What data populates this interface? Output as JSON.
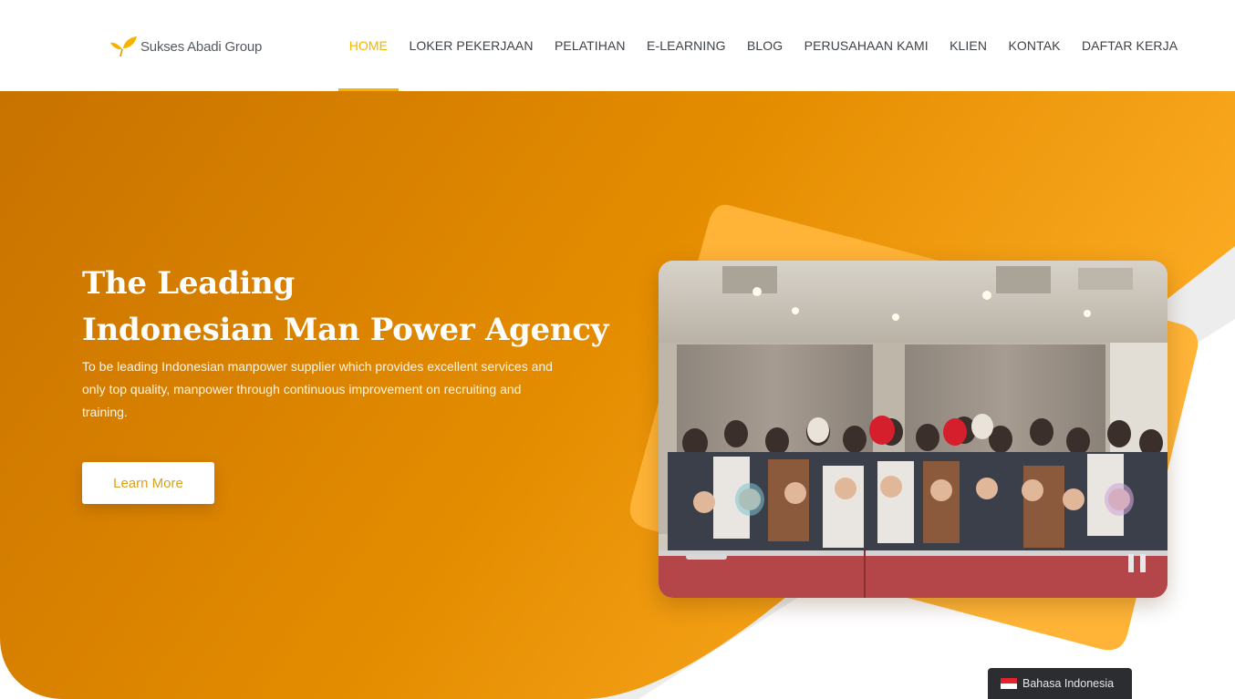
{
  "brand": {
    "name": "Sukses Abadi Group",
    "logo_icon": "leaf-icon",
    "logo_color": "#f4b400"
  },
  "nav": {
    "items": [
      {
        "label": "HOME",
        "active": true
      },
      {
        "label": "LOKER PEKERJAAN",
        "active": false
      },
      {
        "label": "PELATIHAN",
        "active": false
      },
      {
        "label": "E-LEARNING",
        "active": false
      },
      {
        "label": "BLOG",
        "active": false
      },
      {
        "label": "PERUSAHAAN KAMI",
        "active": false
      },
      {
        "label": "KLIEN",
        "active": false
      },
      {
        "label": "KONTAK",
        "active": false
      },
      {
        "label": "DAFTAR KERJA",
        "active": false
      }
    ]
  },
  "hero": {
    "title_line1": "The Leading",
    "title_line2": "Indonesian Man Power Agency",
    "subtitle": "To be leading Indonesian manpower supplier which provides excellent services and only top quality, manpower through continuous improvement on recruiting and training.",
    "cta_label": "Learn More"
  },
  "language": {
    "label": "Bahasa Indonesia",
    "flag_icon": "indonesia-flag-icon"
  },
  "colors": {
    "accent": "#f4b400",
    "hero_gradient_start": "#c97300",
    "hero_gradient_end": "#fbaa20",
    "card_shape": "#ffb437"
  }
}
